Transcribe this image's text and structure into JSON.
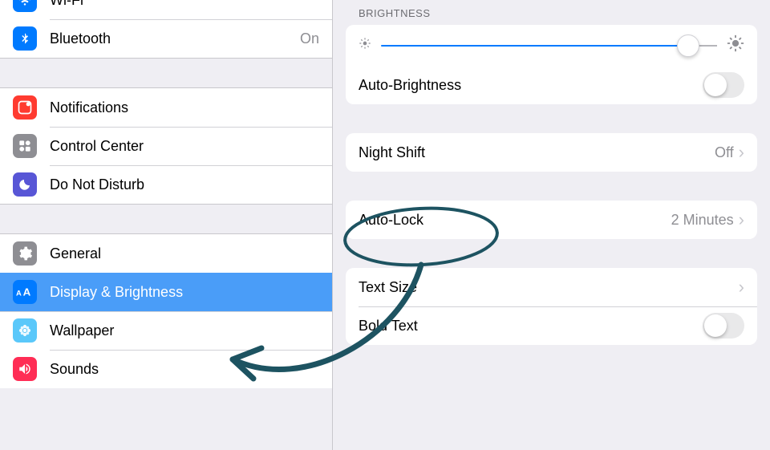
{
  "sidebar": {
    "items": [
      {
        "label": "Wi-Fi",
        "value": ""
      },
      {
        "label": "Bluetooth",
        "value": "On"
      },
      {
        "label": "Notifications"
      },
      {
        "label": "Control Center"
      },
      {
        "label": "Do Not Disturb"
      },
      {
        "label": "General"
      },
      {
        "label": "Display & Brightness"
      },
      {
        "label": "Wallpaper"
      },
      {
        "label": "Sounds"
      }
    ]
  },
  "detail": {
    "section_header": "BRIGHTNESS",
    "auto_brightness_label": "Auto-Brightness",
    "night_shift_label": "Night Shift",
    "night_shift_value": "Off",
    "auto_lock_label": "Auto-Lock",
    "auto_lock_value": "2 Minutes",
    "text_size_label": "Text Size",
    "bold_text_label": "Bold Text"
  },
  "icons": {
    "wifi": "wifi-icon",
    "bluetooth": "bluetooth-icon",
    "notifications": "notifications-icon",
    "control_center": "control-center-icon",
    "dnd": "moon-icon",
    "general": "gear-icon",
    "display": "text-size-icon",
    "wallpaper": "flower-icon",
    "sounds": "speaker-icon"
  },
  "colors": {
    "selected": "#4a9df8",
    "blue": "#007aff",
    "red": "#ff3b30",
    "gray": "#8e8e93",
    "cyan": "#5ac8fa",
    "orange": "#ff9500",
    "purple": "#5856d6",
    "annotation": "#1d5361"
  }
}
